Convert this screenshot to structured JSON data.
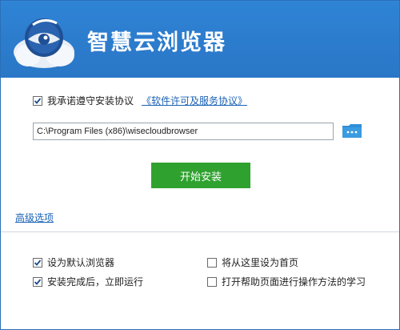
{
  "header": {
    "title": "智慧云浏览器",
    "logo_icon": "cloud-eye-logo-icon",
    "colors": {
      "banner": "#2c7bcc",
      "link": "#1a62b6",
      "install": "#2fa12f"
    }
  },
  "agreement": {
    "checked": true,
    "text": "我承诺遵守安装协议",
    "link": "《软件许可及服务协议》"
  },
  "install_path": {
    "value": "C:\\Program Files (x86)\\wisecloudbrowser"
  },
  "folder_icon": "folder-icon",
  "install_button": {
    "label": "开始安装"
  },
  "advanced_link": "高级选项",
  "options": {
    "set_default": {
      "label": "设为默认浏览器",
      "checked": true
    },
    "run_after_install": {
      "label": "安装完成后，立即运行",
      "checked": true
    },
    "set_homepage": {
      "label": "将从这里设为首页",
      "checked": false
    },
    "open_help": {
      "label": "打开帮助页面进行操作方法的学习",
      "checked": false
    }
  }
}
